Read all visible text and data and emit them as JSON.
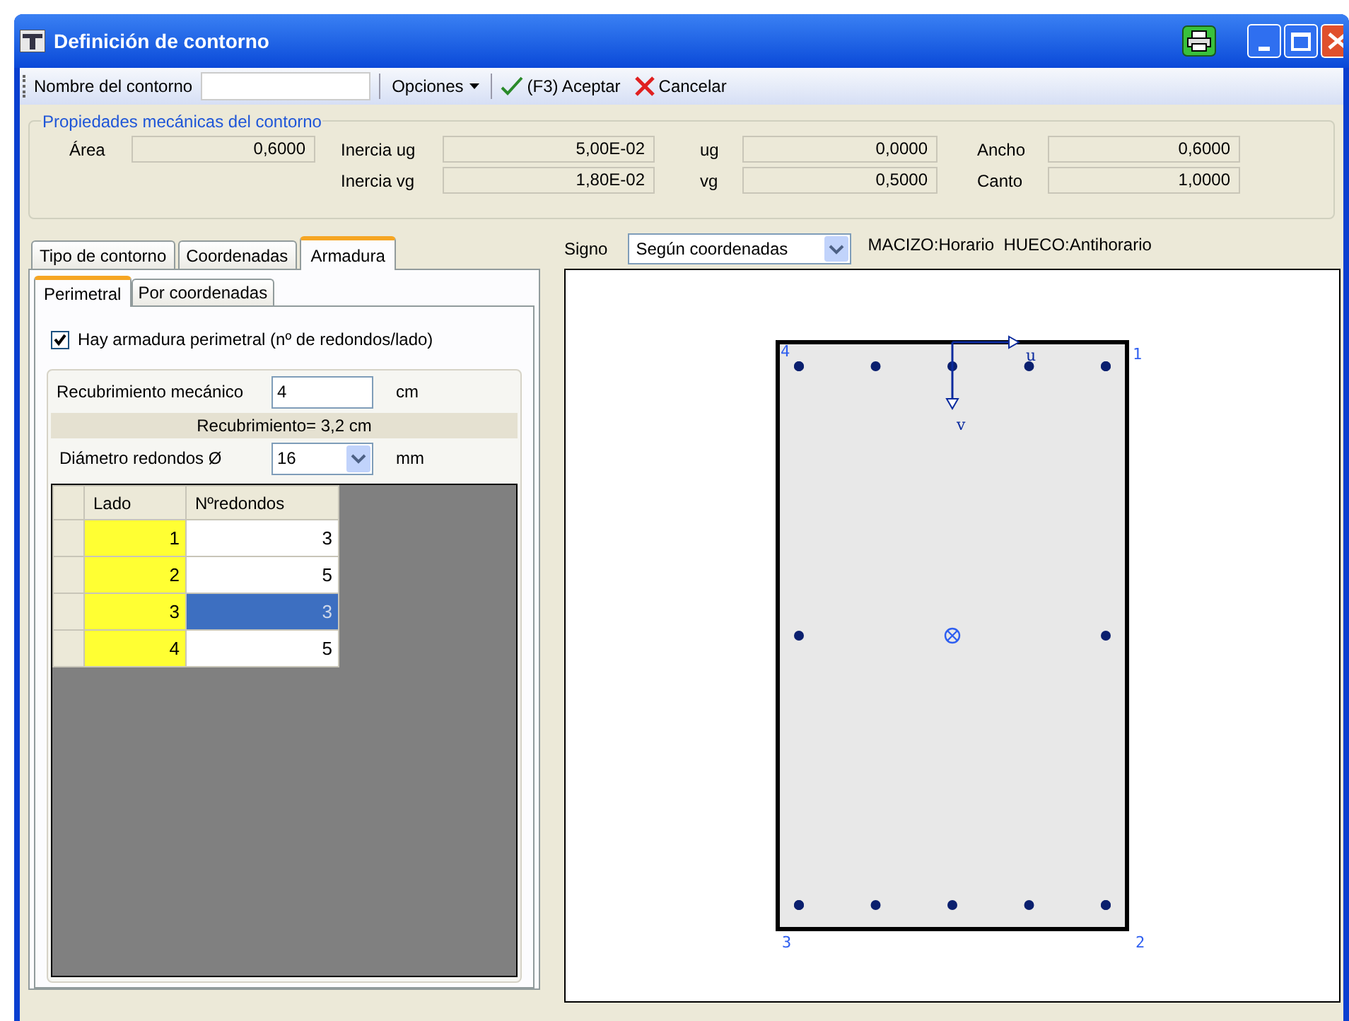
{
  "window": {
    "title": "Definición de contorno"
  },
  "toolbar": {
    "name_label": "Nombre del contorno",
    "options": "Opciones",
    "accept": "(F3) Aceptar",
    "cancel": "Cancelar"
  },
  "properties": {
    "title": "Propiedades mecánicas del contorno",
    "rows": [
      [
        {
          "label": "Área",
          "value": "0,6000"
        },
        {
          "label": "Inercia ug",
          "value": "5,00E-02"
        },
        {
          "label": "ug",
          "value": "0,0000"
        },
        {
          "label": "Ancho",
          "value": "0,6000"
        }
      ],
      [
        null,
        {
          "label": "Inercia vg",
          "value": "1,80E-02"
        },
        {
          "label": "vg",
          "value": "0,5000"
        },
        {
          "label": "Canto",
          "value": "1,0000"
        }
      ]
    ]
  },
  "tabs": [
    {
      "label": "Tipo de contorno",
      "selected": false
    },
    {
      "label": "Coordenadas",
      "selected": false
    },
    {
      "label": "Armadura",
      "selected": true
    }
  ],
  "subtabs": [
    {
      "label": "Perimetral",
      "selected": true
    },
    {
      "label": "Por coordenadas",
      "selected": false
    }
  ],
  "perimeter": {
    "label": "Hay armadura perimetral  (nº de redondos/lado)",
    "checked": true
  },
  "cover": {
    "label": "Recubrimiento mecánico",
    "value": "4",
    "unit": "cm",
    "info": "Recubrimiento= 3,2 cm"
  },
  "diameter": {
    "label": "Diámetro redondos Ø",
    "value": "16",
    "unit": "mm"
  },
  "grid": {
    "columns": [
      "Lado",
      "Nºredondos"
    ],
    "rows": [
      {
        "side": "1",
        "count": "3",
        "selected": false
      },
      {
        "side": "2",
        "count": "5",
        "selected": false
      },
      {
        "side": "3",
        "count": "3",
        "selected": true
      },
      {
        "side": "4",
        "count": "5",
        "selected": false
      }
    ]
  },
  "sign": {
    "label": "Signo",
    "value": "Según coordenadas",
    "legend": "MACIZO:Horario  HUECO:Antihorario"
  },
  "section": {
    "corner_labels": [
      "4",
      "1",
      "3",
      "2"
    ],
    "axis_labels": [
      "u",
      "v"
    ]
  }
}
